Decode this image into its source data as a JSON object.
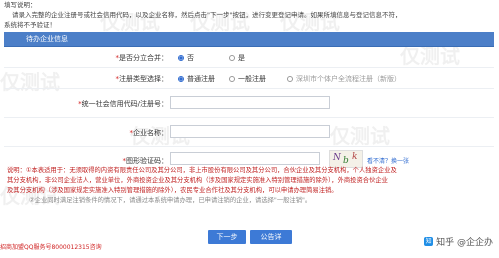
{
  "top_note": {
    "line1": "填写说明：",
    "line2": "请录入完整的企业注册号或社会信用代码，以及企业名称，然后点击\"下一步\"按钮，进行变更登记申请。如果所填信息与登记信息不符，",
    "line3": "系统将不予验证！"
  },
  "section": {
    "title": "待办企业信息"
  },
  "form": {
    "branch": {
      "label": "是否分立合并：",
      "options": [
        "否",
        "是"
      ],
      "selected": "否"
    },
    "reg_type": {
      "label": "注册类型选择：",
      "options": [
        "普通注册",
        "一般注册",
        "深圳市个体户全流程注册（新版）"
      ],
      "selected": "普通注册"
    },
    "credit_code": {
      "label": "统一社会信用代码/注册号：",
      "value": ""
    },
    "company_name": {
      "label": "企业名称：",
      "value": ""
    },
    "captcha": {
      "label": "图形验证码：",
      "value": "",
      "chars": [
        "N",
        "b",
        "k"
      ],
      "tip": "看不清？换一张"
    }
  },
  "notice": {
    "line1": "说明：①本表适用于：无须取得的内资有限责任公司及其分公司，非上市股份有限公司及其分公司，合伙企业及其分支机构，个人独资企业及",
    "line2": "其分支机构，非公司企业法人，营业单位，外商投资企业及其分支机构（涉及国家规定实施准入特别管理措施的除外），外商投资合伙企业",
    "line3": "及其分支机构（涉及国家规定实施准入特别管理措施的除外），农民专业合作社及其分支机构，可以申请办理简易注销。",
    "line4": "②企业同时满足注销条件的情况下，请通过本系统申请办理，已申请注销的企业，请选择\"一般注销\"。"
  },
  "buttons": {
    "next": "下一步",
    "detail": "公告详情"
  },
  "footer": {
    "link": "招商加盟QQ服务号8000012315咨询"
  },
  "brand": {
    "text": "知乎 @企企办",
    "logo": "知"
  },
  "watermark": "仅测试",
  "colors": {
    "accent": "#4c7fc8",
    "button": "#3d7ad6",
    "warning": "#c02020"
  }
}
